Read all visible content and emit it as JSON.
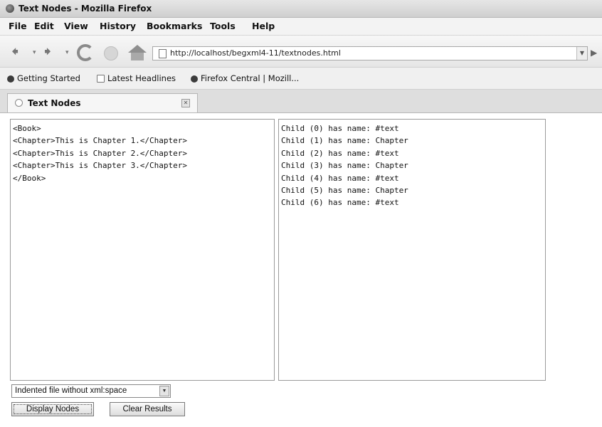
{
  "window": {
    "title": "Text Nodes - Mozilla Firefox"
  },
  "menu": [
    "File",
    "Edit",
    "View",
    "History",
    "Bookmarks",
    "Tools",
    "Help"
  ],
  "navigation": {
    "url": "http://localhost/begxml4-11/textnodes.html"
  },
  "bookmarks": [
    "Getting Started",
    "Latest Headlines",
    "Firefox Central | Mozill..."
  ],
  "tab": {
    "label": "Text Nodes"
  },
  "left_pane": {
    "lines": [
      "<Book>",
      "<Chapter>This is Chapter 1.</Chapter>",
      "<Chapter>This is Chapter 2.</Chapter>",
      "<Chapter>This is Chapter 3.</Chapter>",
      "</Book>"
    ]
  },
  "right_pane": {
    "lines": [
      "Child (0) has name: #text",
      "Child (1) has name: Chapter",
      "Child (2) has name: #text",
      "Child (3) has name: Chapter",
      "Child (4) has name: #text",
      "Child (5) has name: Chapter",
      "Child (6) has name: #text"
    ]
  },
  "controls": {
    "select_value": "Indented file without xml:space",
    "display_button": "Display Nodes",
    "clear_button": "Clear Results"
  }
}
